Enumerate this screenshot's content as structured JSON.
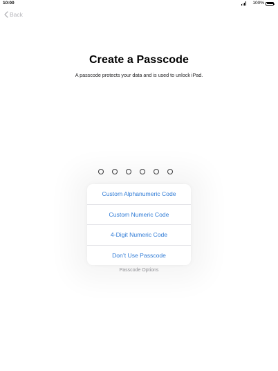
{
  "status_bar": {
    "time": "10:00",
    "battery_percent": "100%",
    "signal_icon": "signal-bars-icon",
    "battery_icon": "battery-full-icon"
  },
  "nav": {
    "back_label": "Back",
    "back_icon": "chevron-left-icon"
  },
  "header": {
    "title": "Create a Passcode",
    "subtitle": "A passcode protects your data and is used to unlock iPad."
  },
  "passcode": {
    "digit_count": 6,
    "entered": 0
  },
  "options_menu": {
    "items": [
      {
        "label": "Custom Alphanumeric Code"
      },
      {
        "label": "Custom Numeric Code"
      },
      {
        "label": "4-Digit Numeric Code"
      },
      {
        "label": "Don’t Use Passcode"
      }
    ],
    "footer_label": "Passcode Options"
  },
  "colors": {
    "accent": "#2f7bd6",
    "back_disabled": "#b4b4b9",
    "secondary_text": "#8e8e93"
  }
}
